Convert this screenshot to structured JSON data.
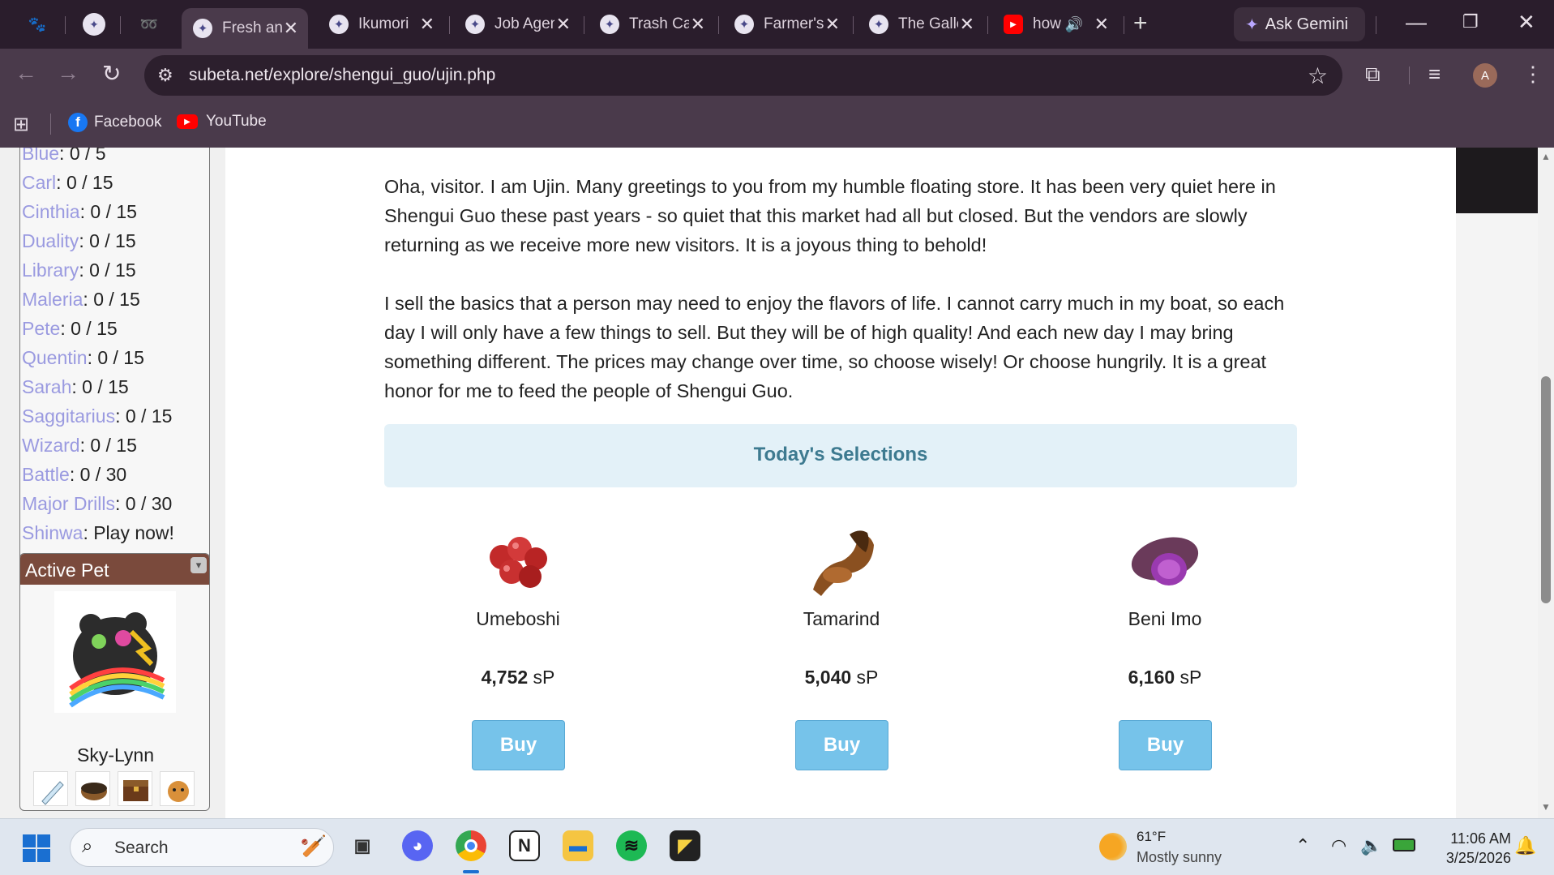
{
  "browser": {
    "tabs": [
      {
        "title": "Fresh and Tasty",
        "active": true
      },
      {
        "title": "Ikumori"
      },
      {
        "title": "Job Agency"
      },
      {
        "title": "Trash Can"
      },
      {
        "title": "Farmer's"
      },
      {
        "title": "The Gallery"
      },
      {
        "title": "how"
      }
    ],
    "new_tab": "+",
    "gemini_label": "Ask Gemini",
    "url": "subeta.net/explore/shengui_guo/ujin.php",
    "profile_initial": "A",
    "bookmarks": [
      {
        "label": "Facebook"
      },
      {
        "label": "YouTube"
      }
    ]
  },
  "sidebar": {
    "quests": [
      {
        "name": "Blue",
        "value": ": 0 / 5"
      },
      {
        "name": "Carl",
        "value": ": 0 / 15"
      },
      {
        "name": "Cinthia",
        "value": ": 0 / 15"
      },
      {
        "name": "Duality",
        "value": ": 0 / 15"
      },
      {
        "name": "Library",
        "value": ": 0 / 15"
      },
      {
        "name": "Maleria",
        "value": ": 0 / 15"
      },
      {
        "name": "Pete",
        "value": ": 0 / 15"
      },
      {
        "name": "Quentin",
        "value": ": 0 / 15"
      },
      {
        "name": "Sarah",
        "value": ": 0 / 15"
      },
      {
        "name": "Saggitarius",
        "value": ": 0 / 15"
      },
      {
        "name": "Wizard",
        "value": ": 0 / 15"
      },
      {
        "name": "Battle",
        "value": ": 0 / 30"
      },
      {
        "name": "Major Drills",
        "value": ": 0 / 30"
      },
      {
        "name": "Shinwa",
        "value": ": Play now!"
      }
    ],
    "active_pet": {
      "heading": "Active Pet",
      "name": "Sky-Lynn"
    }
  },
  "shop": {
    "intro_1": "Oha, visitor. I am Ujin. Many greetings to you from my humble floating store. It has been very quiet here in Shengui Guo these past years - so quiet that this market had all but closed. But the vendors are slowly returning as we receive more new visitors. It is a joyous thing to behold!",
    "intro_2": "I sell the basics that a person may need to enjoy the flavors of life. I cannot carry much in my boat, so each day I will only have a few things to sell. But they will be of high quality! And each new day I may bring something different. The prices may change over time, so choose wisely! Or choose hungrily. It is a great honor for me to feed the people of Shengui Guo.",
    "selections_title": "Today's Selections",
    "items": [
      {
        "name": "Umeboshi",
        "price": "4,752",
        "currency": "sP",
        "buy": "Buy"
      },
      {
        "name": "Tamarind",
        "price": "5,040",
        "currency": "sP",
        "buy": "Buy"
      },
      {
        "name": "Beni Imo",
        "price": "6,160",
        "currency": "sP",
        "buy": "Buy"
      }
    ]
  },
  "taskbar": {
    "search_placeholder": "Search",
    "weather_temp": "61°F",
    "weather_desc": "Mostly sunny",
    "time": "11:06 AM",
    "date": "3/25/2026"
  }
}
